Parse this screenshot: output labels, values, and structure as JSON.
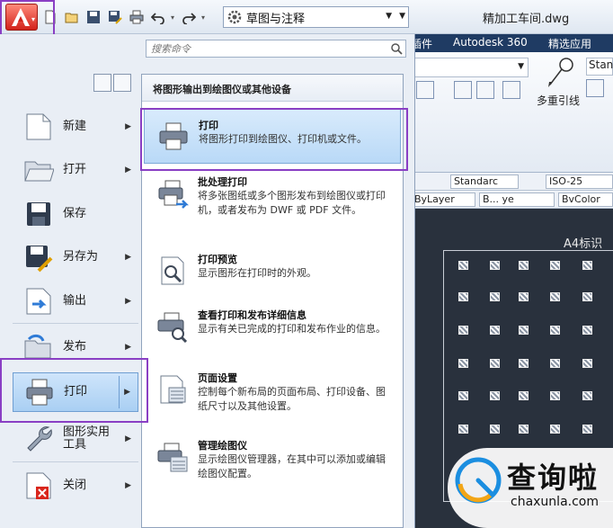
{
  "titlebar": {
    "workspace": "草图与注释",
    "document_title": "精加工车间.dwg"
  },
  "ribbon": {
    "tabs": [
      "插件",
      "Autodesk 360",
      "精选应用"
    ],
    "leader_label": "多重引线",
    "style_dropdown": "Stan",
    "annotation_style": "Standarc",
    "dim_style": "ISO-25",
    "layer_value": "ByLayer",
    "linetype_value": "B... ye",
    "color_value": "BvColor"
  },
  "canvas": {
    "sheet_label": "A4标识"
  },
  "app_menu": {
    "search_placeholder": "搜索命令",
    "left_items": [
      {
        "label": "新建",
        "icon": "new-icon"
      },
      {
        "label": "打开",
        "icon": "open-folder-icon"
      },
      {
        "label": "保存",
        "icon": "save-icon"
      },
      {
        "label": "另存为",
        "icon": "save-as-icon"
      },
      {
        "label": "输出",
        "icon": "export-icon"
      },
      {
        "label": "发布",
        "icon": "publish-icon"
      },
      {
        "label": "打印",
        "icon": "printer-icon"
      },
      {
        "label": "图形实用工具",
        "line1": "图形实用",
        "line2": "工具",
        "icon": "wrench-icon"
      },
      {
        "label": "关闭",
        "icon": "close-document-icon"
      }
    ],
    "submenu": {
      "header": "将图形输出到绘图仪或其他设备",
      "items": [
        {
          "title": "打印",
          "desc": "将图形打印到绘图仪、打印机或文件。"
        },
        {
          "title": "批处理打印",
          "desc": "将多张图纸或多个图形发布到绘图仪或打印机，或者发布为 DWF 或 PDF 文件。"
        },
        {
          "title": "打印预览",
          "desc": "显示图形在打印时的外观。"
        },
        {
          "title": "查看打印和发布详细信息",
          "desc": "显示有关已完成的打印和发布作业的信息。"
        },
        {
          "title": "页面设置",
          "desc": "控制每个新布局的页面布局、打印设备、图纸尺寸以及其他设置。"
        },
        {
          "title": "管理绘图仪",
          "desc": "显示绘图仪管理器，在其中可以添加或编辑绘图仪配置。"
        }
      ]
    }
  },
  "watermark": {
    "name": "查询啦",
    "url": "chaxunla.com"
  },
  "colors": {
    "highlight_box": "#8a3fc4",
    "app_button": "#d2221a",
    "active_item": "#b9d9f7",
    "ribbon_tabs": "#1f3b63",
    "canvas": "#29313d"
  }
}
